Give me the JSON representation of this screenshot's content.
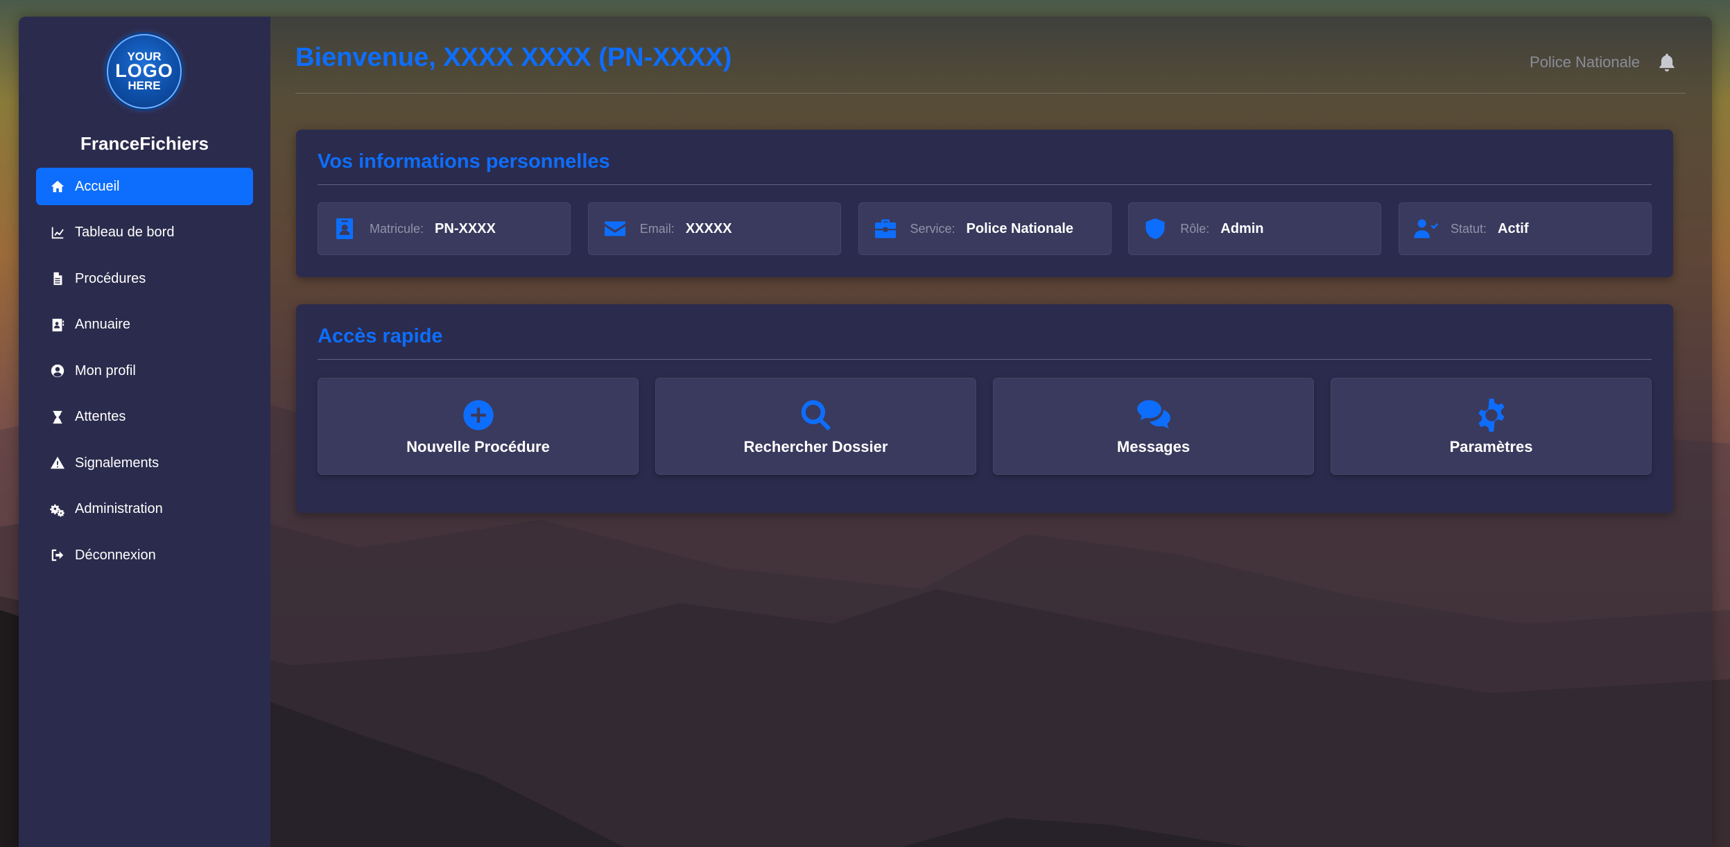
{
  "sidebar": {
    "logo": {
      "line1": "YOUR",
      "line2": "LOGO",
      "line3": "HERE"
    },
    "brand": "FranceFichiers",
    "items": [
      {
        "label": "Accueil",
        "icon": "home-icon",
        "active": true
      },
      {
        "label": "Tableau de bord",
        "icon": "chart-line-icon",
        "active": false
      },
      {
        "label": "Procédures",
        "icon": "file-icon",
        "active": false
      },
      {
        "label": "Annuaire",
        "icon": "address-book-icon",
        "active": false
      },
      {
        "label": "Mon profil",
        "icon": "user-circle-icon",
        "active": false
      },
      {
        "label": "Attentes",
        "icon": "hourglass-icon",
        "active": false
      },
      {
        "label": "Signalements",
        "icon": "warning-icon",
        "active": false
      },
      {
        "label": "Administration",
        "icon": "cogs-icon",
        "active": false
      },
      {
        "label": "Déconnexion",
        "icon": "sign-out-icon",
        "active": false
      }
    ]
  },
  "header": {
    "welcome": "Bienvenue, XXXX XXXX (PN-XXXX)",
    "service": "Police Nationale",
    "bell_icon": "bell-icon"
  },
  "personal_info": {
    "title": "Vos informations personnelles",
    "fields": [
      {
        "label": "Matricule:",
        "value": "PN-XXXX",
        "icon": "id-badge-icon"
      },
      {
        "label": "Email:",
        "value": "XXXXX",
        "icon": "envelope-icon"
      },
      {
        "label": "Service:",
        "value": "Police Nationale",
        "icon": "briefcase-icon"
      },
      {
        "label": "Rôle:",
        "value": "Admin",
        "icon": "shield-icon"
      },
      {
        "label": "Statut:",
        "value": "Actif",
        "icon": "user-check-icon"
      }
    ]
  },
  "quick_access": {
    "title": "Accès rapide",
    "items": [
      {
        "label": "Nouvelle Procédure",
        "icon": "plus-circle-icon"
      },
      {
        "label": "Rechercher Dossier",
        "icon": "search-icon"
      },
      {
        "label": "Messages",
        "icon": "comments-icon"
      },
      {
        "label": "Paramètres",
        "icon": "cog-icon"
      }
    ]
  },
  "colors": {
    "accent": "#0d6efd",
    "sidebar_bg": "#2b2b4d",
    "tile_bg": "#3a3a5e"
  }
}
